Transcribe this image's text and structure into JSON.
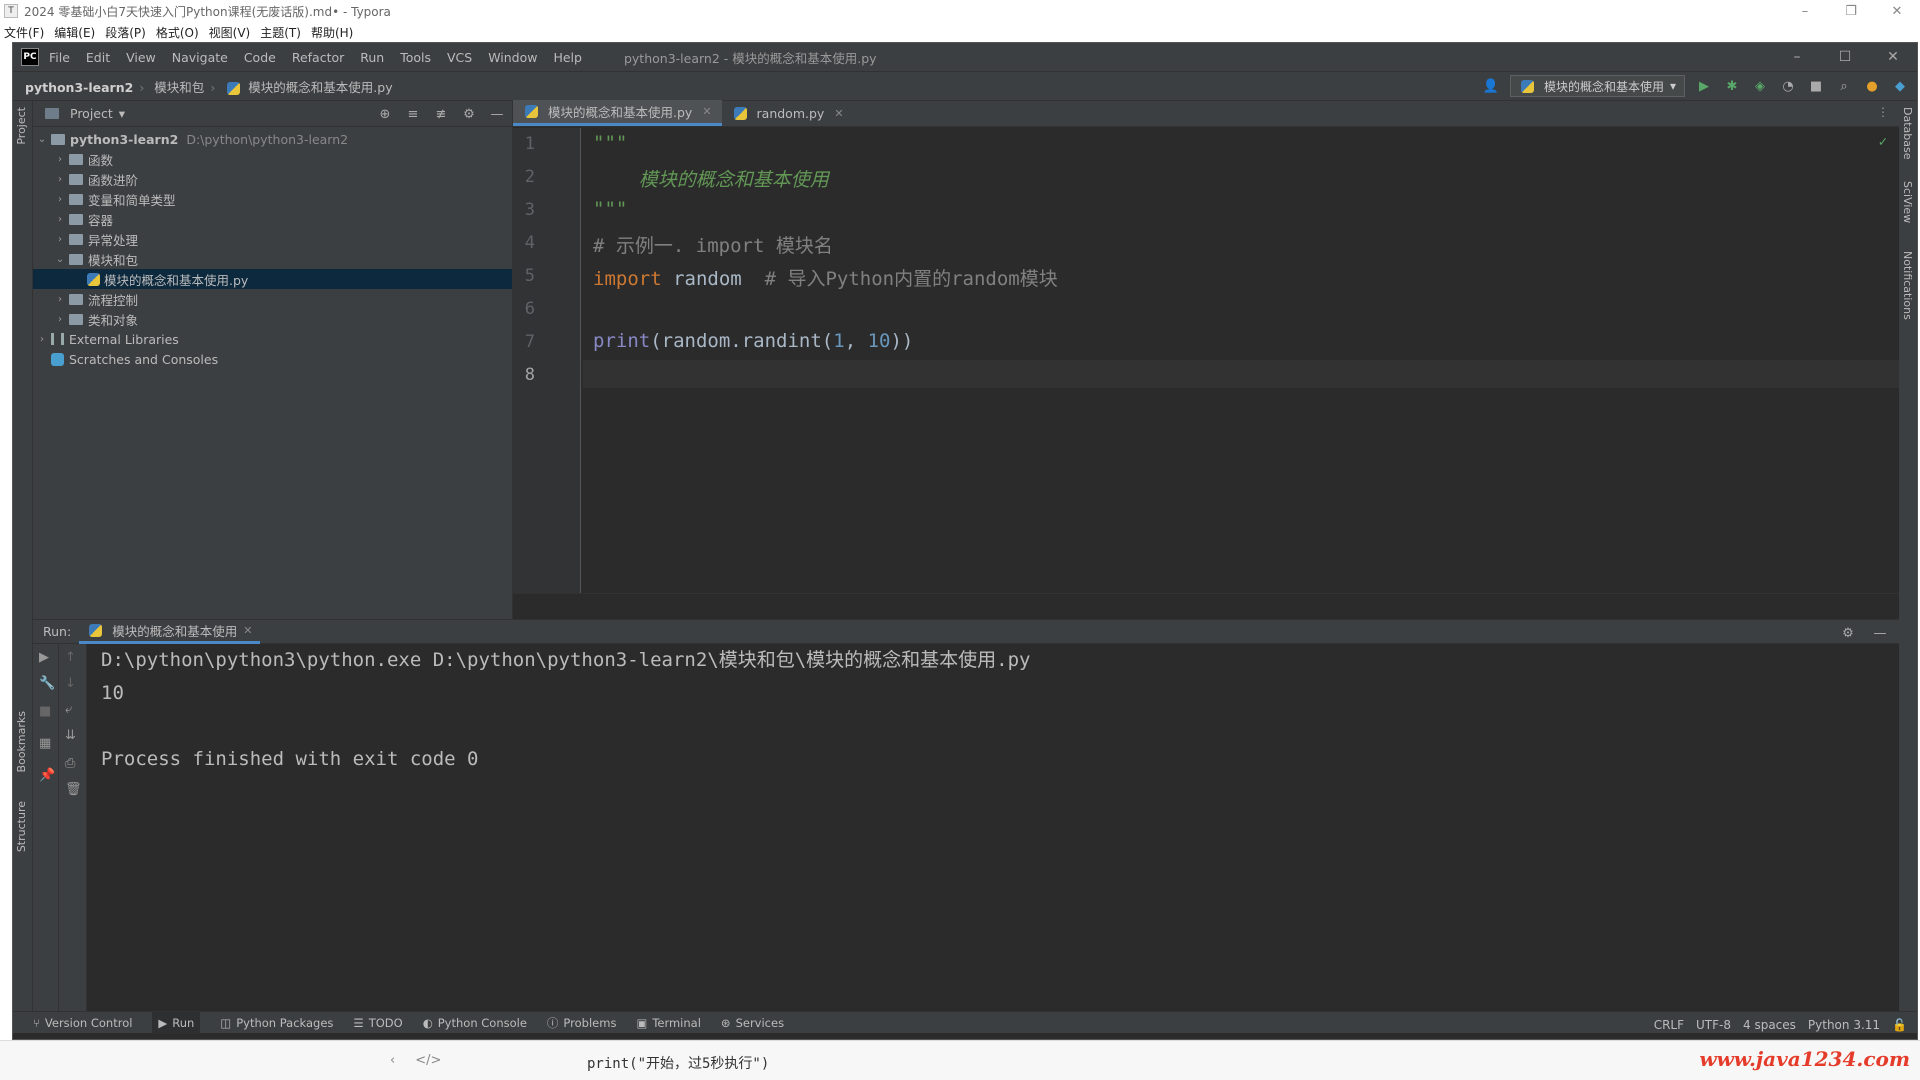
{
  "typora": {
    "title": "2024 零基础小白7天快速入门Python课程(无废话版).md• - Typora",
    "menu": [
      "文件(F)",
      "编辑(E)",
      "段落(P)",
      "格式(O)",
      "视图(V)",
      "主题(T)",
      "帮助(H)"
    ],
    "bottom_code": "print(\"开始，过5秒执行\")",
    "watermark": "www.java1234.com"
  },
  "ide": {
    "logo": "PC",
    "menu": [
      "File",
      "Edit",
      "View",
      "Navigate",
      "Code",
      "Refactor",
      "Run",
      "Tools",
      "VCS",
      "Window",
      "Help"
    ],
    "window_title": "python3-learn2 - 模块的概念和基本使用.py",
    "breadcrumb": [
      "python3-learn2",
      "模块和包",
      "模块的概念和基本使用.py"
    ],
    "run_config": "模块的概念和基本使用"
  },
  "left_strip": {
    "project": "Project",
    "bookmarks": "Bookmarks",
    "structure": "Structure"
  },
  "right_strip": {
    "database": "Database",
    "sciview": "SciView",
    "notifications": "Notifications"
  },
  "project": {
    "header": "Project",
    "root": "python3-learn2",
    "root_path": "D:\\python\\python3-learn2",
    "folders": [
      "函数",
      "函数进阶",
      "变量和简单类型",
      "容器",
      "异常处理",
      "模块和包"
    ],
    "selected_file": "模块的概念和基本使用.py",
    "folders_after": [
      "流程控制",
      "类和对象"
    ],
    "external_libraries": "External Libraries",
    "scratches": "Scratches and Consoles"
  },
  "editor": {
    "tabs": [
      "模块的概念和基本使用.py",
      "random.py"
    ],
    "line_numbers": [
      "1",
      "2",
      "3",
      "4",
      "5",
      "6",
      "7",
      "8"
    ],
    "code": {
      "l1": "\"\"\"",
      "l2": "    模块的概念和基本使用",
      "l3": "\"\"\"",
      "l4": "# 示例一. import 模块名",
      "l5_kw": "import",
      "l5_mod": " random  ",
      "l5_comment": "# 导入Python内置的random模块",
      "l7_fn": "print",
      "l7_a": "(random.randint(",
      "l7_n1": "1",
      "l7_b": ", ",
      "l7_n2": "10",
      "l7_c": "))"
    }
  },
  "run": {
    "label": "Run:",
    "tab": "模块的概念和基本使用",
    "console": [
      "D:\\python\\python3\\python.exe D:\\python\\python3-learn2\\模块和包\\模块的概念和基本使用.py",
      "10",
      "",
      "Process finished with exit code 0"
    ]
  },
  "tool_windows": [
    "Version Control",
    "Run",
    "Python Packages",
    "TODO",
    "Python Console",
    "Problems",
    "Terminal",
    "Services"
  ],
  "status": {
    "line_sep": "CRLF",
    "encoding": "UTF-8",
    "indent": "4 spaces",
    "interpreter": "Python 3.11"
  }
}
